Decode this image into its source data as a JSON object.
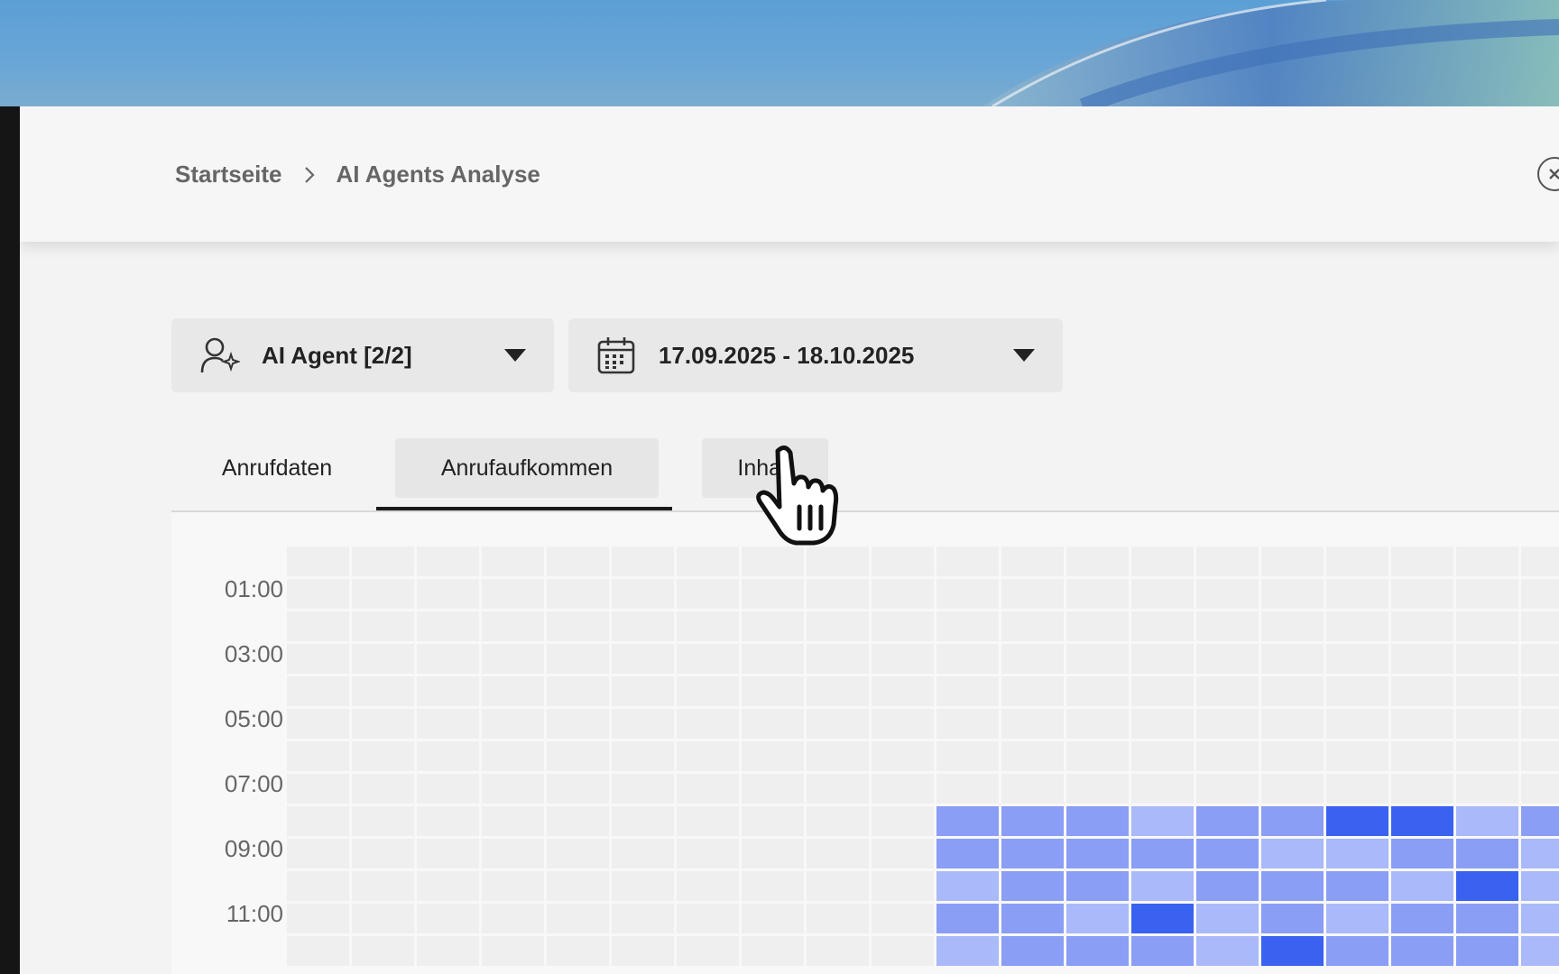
{
  "breadcrumb": {
    "home": "Startseite",
    "current": "AI Agents Analyse"
  },
  "close_icon": "close-circle-icon",
  "filters": {
    "agent": {
      "label": "AI Agent [2/2]",
      "icon": "user-sparkle-icon"
    },
    "date": {
      "label": "17.09.2025 - 18.10.2025",
      "icon": "calendar-icon"
    }
  },
  "tabs": [
    {
      "label": "Anrufdaten",
      "active": false
    },
    {
      "label": "Anrufaufkommen",
      "active": true
    },
    {
      "label": "Inhalt",
      "active": false
    }
  ],
  "heatmap": {
    "y_labels": [
      "01:00",
      "03:00",
      "05:00",
      "07:00",
      "09:00",
      "11:00"
    ],
    "colors": {
      "0": "#efefef",
      "1": "#aab9f9",
      "2": "#8a9ef6",
      "3": "#3a62f0"
    },
    "rows": [
      [
        0,
        0,
        0,
        0,
        0,
        0,
        0,
        0,
        0,
        0,
        0,
        0,
        0,
        0,
        0,
        0,
        0,
        0,
        0,
        0
      ],
      [
        0,
        0,
        0,
        0,
        0,
        0,
        0,
        0,
        0,
        0,
        0,
        0,
        0,
        0,
        0,
        0,
        0,
        0,
        0,
        0
      ],
      [
        0,
        0,
        0,
        0,
        0,
        0,
        0,
        0,
        0,
        0,
        0,
        0,
        0,
        0,
        0,
        0,
        0,
        0,
        0,
        0
      ],
      [
        0,
        0,
        0,
        0,
        0,
        0,
        0,
        0,
        0,
        0,
        0,
        0,
        0,
        0,
        0,
        0,
        0,
        0,
        0,
        0
      ],
      [
        0,
        0,
        0,
        0,
        0,
        0,
        0,
        0,
        0,
        0,
        0,
        0,
        0,
        0,
        0,
        0,
        0,
        0,
        0,
        0
      ],
      [
        0,
        0,
        0,
        0,
        0,
        0,
        0,
        0,
        0,
        0,
        0,
        0,
        0,
        0,
        0,
        0,
        0,
        0,
        0,
        0
      ],
      [
        0,
        0,
        0,
        0,
        0,
        0,
        0,
        0,
        0,
        0,
        0,
        0,
        0,
        0,
        0,
        0,
        0,
        0,
        0,
        0
      ],
      [
        0,
        0,
        0,
        0,
        0,
        0,
        0,
        0,
        0,
        0,
        0,
        0,
        0,
        0,
        0,
        0,
        0,
        0,
        0,
        0
      ],
      [
        0,
        0,
        0,
        0,
        0,
        0,
        0,
        0,
        0,
        0,
        2,
        2,
        2,
        1,
        2,
        2,
        3,
        3,
        1,
        2
      ],
      [
        0,
        0,
        0,
        0,
        0,
        0,
        0,
        0,
        0,
        0,
        2,
        2,
        2,
        2,
        2,
        1,
        1,
        2,
        2,
        1
      ],
      [
        0,
        0,
        0,
        0,
        0,
        0,
        0,
        0,
        0,
        0,
        1,
        2,
        2,
        1,
        2,
        2,
        2,
        1,
        3,
        1
      ],
      [
        0,
        0,
        0,
        0,
        0,
        0,
        0,
        0,
        0,
        0,
        2,
        2,
        1,
        3,
        1,
        2,
        1,
        2,
        2,
        1
      ],
      [
        0,
        0,
        0,
        0,
        0,
        0,
        0,
        0,
        0,
        0,
        1,
        2,
        2,
        2,
        1,
        3,
        2,
        2,
        2,
        1
      ]
    ]
  }
}
